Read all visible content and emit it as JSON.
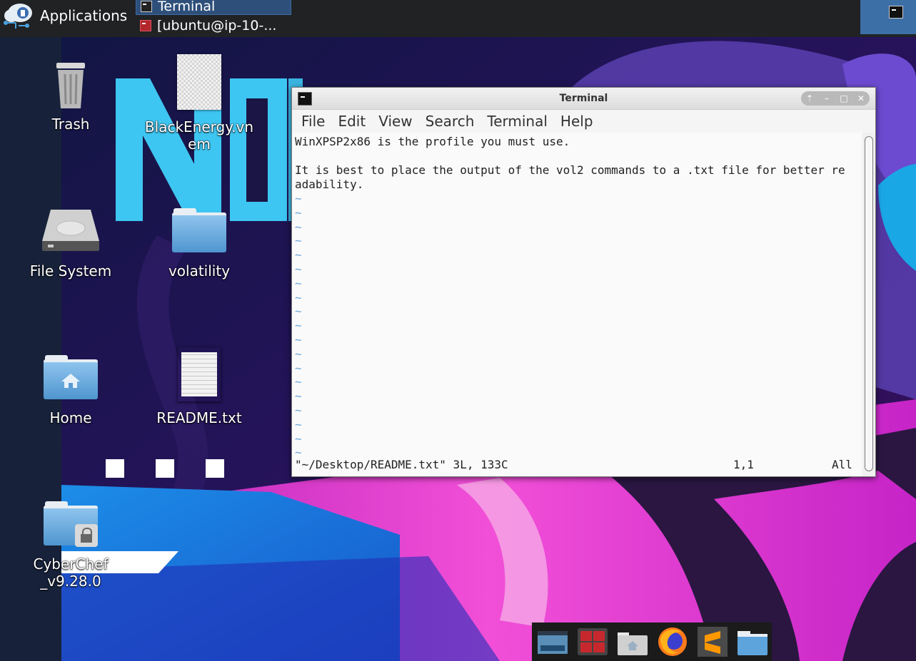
{
  "top_panel": {
    "applications_label": "Applications",
    "tasks": [
      {
        "label": "Terminal"
      },
      {
        "label": "[ubuntu@ip-10-..."
      }
    ]
  },
  "desktop": {
    "icons": [
      {
        "label": "Trash"
      },
      {
        "label": "BlackEnergy.vnem"
      },
      {
        "label": "File System"
      },
      {
        "label": "volatility"
      },
      {
        "label": "Home"
      },
      {
        "label": "README.txt"
      },
      {
        "label": "CyberChef_v9.28.0"
      }
    ],
    "wallpaper_text": "NDRVW"
  },
  "terminal": {
    "title": "Terminal",
    "menu": [
      "File",
      "Edit",
      "View",
      "Search",
      "Terminal",
      "Help"
    ],
    "lines": [
      "WinXPSP2x86 is the profile you must use.",
      "",
      "It is best to place the output of the vol2 commands to a .txt file for better re",
      "adability."
    ],
    "tilde": "~",
    "status_file": "\"~/Desktop/README.txt\" 3L, 133C",
    "status_pos": "1,1",
    "status_all": "All"
  },
  "dock": {
    "items": [
      "desktop-icon",
      "terminal-icon",
      "home-folder-icon",
      "firefox-icon",
      "sublime-text-icon",
      "files-icon"
    ]
  },
  "colors": {
    "panel": "#202224",
    "accent": "#3d6fa7",
    "terminal_bg": "#fafafa",
    "tilde": "#6aa6d9"
  }
}
